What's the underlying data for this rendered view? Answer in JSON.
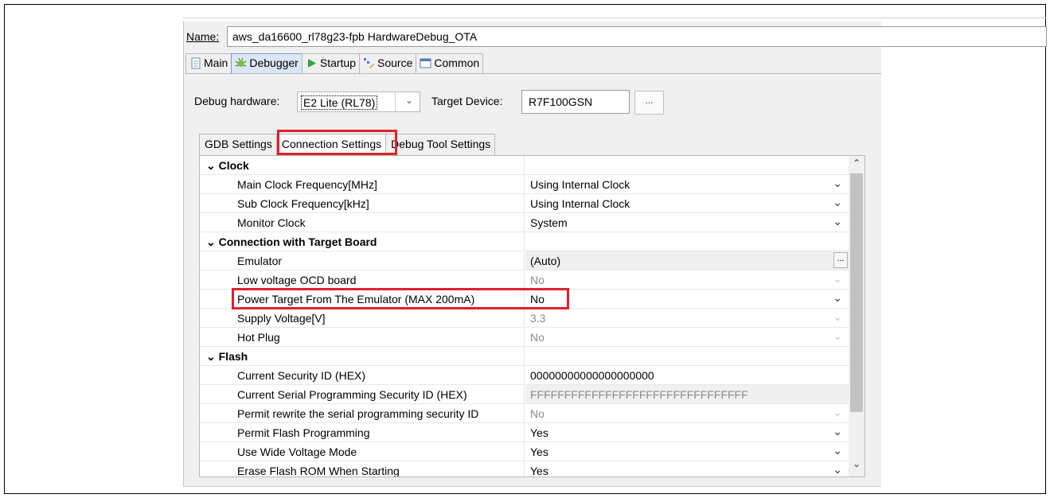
{
  "launch_config": {
    "name_label": "Name:",
    "name_value": "aws_da16600_rl78g23-fpb HardwareDebug_OTA"
  },
  "tabs": [
    {
      "label": "Main",
      "icon": "document-icon"
    },
    {
      "label": "Debugger",
      "icon": "bug-icon"
    },
    {
      "label": "Startup",
      "icon": "play-icon"
    },
    {
      "label": "Source",
      "icon": "source-lookup-icon"
    },
    {
      "label": "Common",
      "icon": "window-icon"
    }
  ],
  "debugger": {
    "hardware_label": "Debug hardware:",
    "hardware_value": "E2 Lite (RL78)",
    "target_label": "Target Device:",
    "target_value": "R7F100GSN",
    "browse_label": "..."
  },
  "subtabs": [
    "GDB Settings",
    "Connection Settings",
    "Debug Tool Settings"
  ],
  "properties": {
    "categories": {
      "clock": "Clock",
      "connection": "Connection with Target Board",
      "flash": "Flash"
    },
    "rows": [
      {
        "name": "Main Clock Frequency[MHz]",
        "value": "Using Internal Clock"
      },
      {
        "name": "Sub Clock Frequency[kHz]",
        "value": "Using Internal Clock"
      },
      {
        "name": "Monitor Clock",
        "value": "System"
      },
      {
        "name": "Emulator",
        "value": "(Auto)"
      },
      {
        "name": "Low voltage OCD board",
        "value": "No"
      },
      {
        "name": "Power Target From The Emulator (MAX 200mA)",
        "value": "No"
      },
      {
        "name": "Supply Voltage[V]",
        "value": "3.3"
      },
      {
        "name": "Hot Plug",
        "value": "No"
      },
      {
        "name": "Current Security ID (HEX)",
        "value": "00000000000000000000"
      },
      {
        "name": "Current Serial Programming Security ID (HEX)",
        "value": "FFFFFFFFFFFFFFFFFFFFFFFFFFFFFFFF"
      },
      {
        "name": "Permit rewrite the serial programming security ID",
        "value": "No"
      },
      {
        "name": "Permit Flash Programming",
        "value": "Yes"
      },
      {
        "name": "Use Wide Voltage Mode",
        "value": "Yes"
      },
      {
        "name": "Erase Flash ROM When Starting",
        "value": "Yes"
      }
    ]
  },
  "colors": {
    "highlight": "#e0202a",
    "active_tab": "#dbe7f5",
    "panel_bg": "#f0f0f0"
  }
}
